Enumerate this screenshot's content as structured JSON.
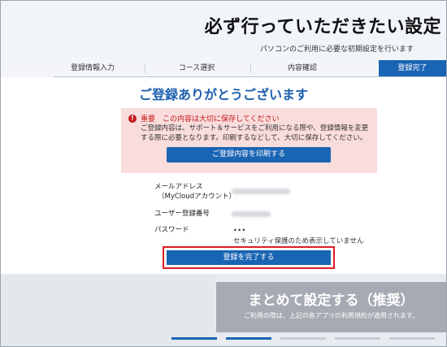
{
  "header": {
    "title": "必ず行っていただきたい設定",
    "subtitle": "パソコンのご利用に必要な初期設定を行います"
  },
  "steps": [
    {
      "label": "登録情報入力",
      "active": false
    },
    {
      "label": "コース選択",
      "active": false
    },
    {
      "label": "内容確認",
      "active": false
    },
    {
      "label": "登録完了",
      "active": true
    }
  ],
  "main": {
    "heading": "ご登録ありがとうございます",
    "notice": {
      "icon": "exclamation-icon",
      "title": "重要　この内容は大切に保存してください",
      "body": "ご登録内容は、サポート＆サービスをご利用になる際や、登録情報を変更する際に必要となります。印刷するなどして、大切に保存してください。",
      "print_button": "ご登録内容を印刷する"
    },
    "info": {
      "email_label": "メールアドレス",
      "email_sub_label": "（MyCloudアカウント）",
      "user_number_label": "ユーザー登録番号",
      "password_label": "パスワード",
      "password_value": "•••",
      "password_note": "セキュリティ保護のため表示していません"
    },
    "complete_button": "登録を完了する"
  },
  "footer": {
    "recommend_title": "まとめて設定する（推奨）",
    "recommend_note": "ご利用の際は、上記の各アプリの利用規約が適用されます。"
  },
  "colors": {
    "accent": "#1a64b4",
    "heading": "#1d5fae",
    "notice_bg": "#f9dcdc",
    "warning": "#c41a1a",
    "highlight_border": "#e01c24"
  }
}
